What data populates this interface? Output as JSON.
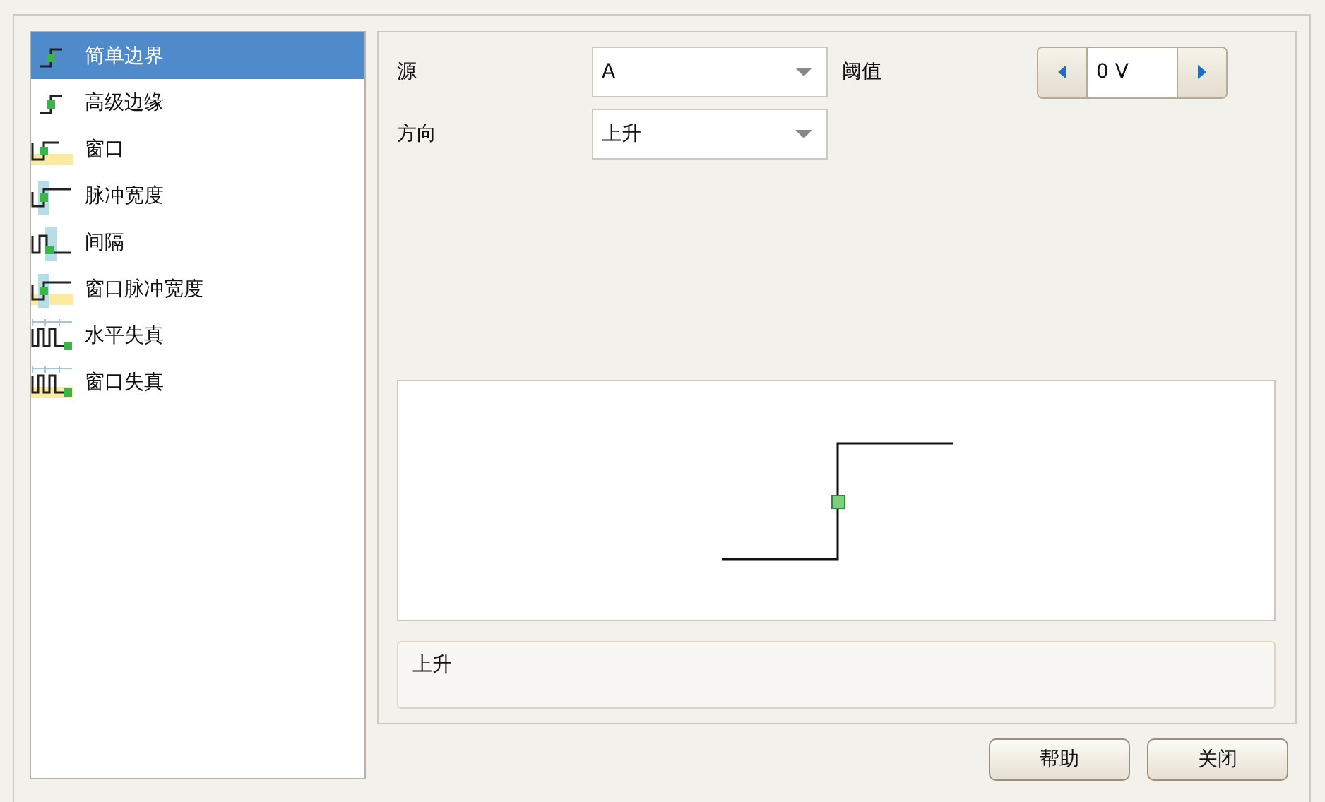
{
  "trigger_types": [
    {
      "label": "简单边界",
      "kind": "simple-edge",
      "selected": true
    },
    {
      "label": "高级边缘",
      "kind": "advanced-edge",
      "selected": false
    },
    {
      "label": "窗口",
      "kind": "window",
      "selected": false
    },
    {
      "label": "脉冲宽度",
      "kind": "pulse-width",
      "selected": false
    },
    {
      "label": "间隔",
      "kind": "interval",
      "selected": false
    },
    {
      "label": "窗口脉冲宽度",
      "kind": "window-pulse-width",
      "selected": false
    },
    {
      "label": "水平失真",
      "kind": "level-dropout",
      "selected": false
    },
    {
      "label": "窗口失真",
      "kind": "window-dropout",
      "selected": false
    }
  ],
  "settings": {
    "source_label": "源",
    "source_value": "A",
    "threshold_label": "阈值",
    "threshold_value": "0 V",
    "direction_label": "方向",
    "direction_value": "上升"
  },
  "description": "上升",
  "buttons": [
    "帮助",
    "关闭"
  ]
}
